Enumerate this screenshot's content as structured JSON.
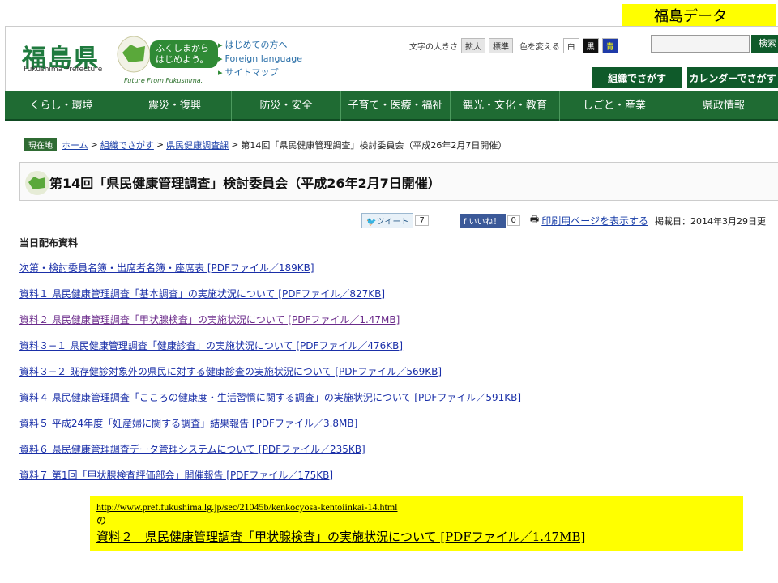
{
  "badge": "福島データ",
  "header": {
    "logo_jp": "福島県",
    "logo_en": "Fukushima Prefecture",
    "slogan": "ふくしまから はじめよう。",
    "future": "Future From Fukushima.",
    "quick_links": [
      "はじめての方へ",
      "Foreign language",
      "サイトマップ"
    ],
    "font_size_label": "文字の大きさ",
    "enlarge": "拡大",
    "standard": "標準",
    "color_label": "色を変える",
    "color_white": "白",
    "color_black": "黒",
    "color_blue": "青",
    "search_button": "検索",
    "tab_org": "組織でさがす",
    "tab_calendar": "カレンダーでさがす"
  },
  "nav": [
    "くらし・環境",
    "震災・復興",
    "防災・安全",
    "子育て・医療・福祉",
    "観光・文化・教育",
    "しごと・産業",
    "県政情報"
  ],
  "breadcrumb": {
    "badge": "現在地",
    "home": "ホーム",
    "org": "組織でさがす",
    "dept": "県民健康調査課",
    "current": "第14回「県民健康管理調査」検討委員会（平成26年2月7日開催）"
  },
  "title": "第14回「県民健康管理調査」検討委員会（平成26年2月7日開催）",
  "share": {
    "tweet": "ツイート",
    "tweet_count": "7",
    "like": "いいね！",
    "like_count": "0",
    "print": "印刷用ページを表示する",
    "posted": "掲載日：2014年3月29日更"
  },
  "section_title": "当日配布資料",
  "documents": [
    "次第・検討委員名簿・出席者名簿・座席表 [PDFファイル／189KB]",
    "資料１ 県民健康管理調査「基本調査」の実施状況について [PDFファイル／827KB]",
    "資料２ 県民健康管理調査「甲状腺検査」の実施状況について [PDFファイル／1.47MB]",
    "資料３−１ 県民健康管理調査「健康診査」の実施状況について [PDFファイル／476KB]",
    "資料３−２ 既存健診対象外の県民に対する健康診査の実施状況について [PDFファイル／569KB]",
    "資料４ 県民健康管理調査「こころの健康度・生活習慣に関する調査」の実施状況について [PDFファイル／591KB]",
    "資料５ 平成24年度「妊産婦に関する調査」結果報告 [PDFファイル／3.8MB]",
    "資料６ 県民健康管理調査データ管理システムについて [PDFファイル／235KB]",
    "資料７ 第1回「甲状腺検査評価部会」開催報告 [PDFファイル／175KB]"
  ],
  "citation": {
    "url": "http://www.pref.fukushima.lg.jp/sec/21045b/kenkocyosa-kentoiinkai-14.html",
    "no": "の",
    "title": "資料２　県民健康管理調査「甲状腺検査」の実施状況について [PDFファイル／1.47MB]"
  }
}
